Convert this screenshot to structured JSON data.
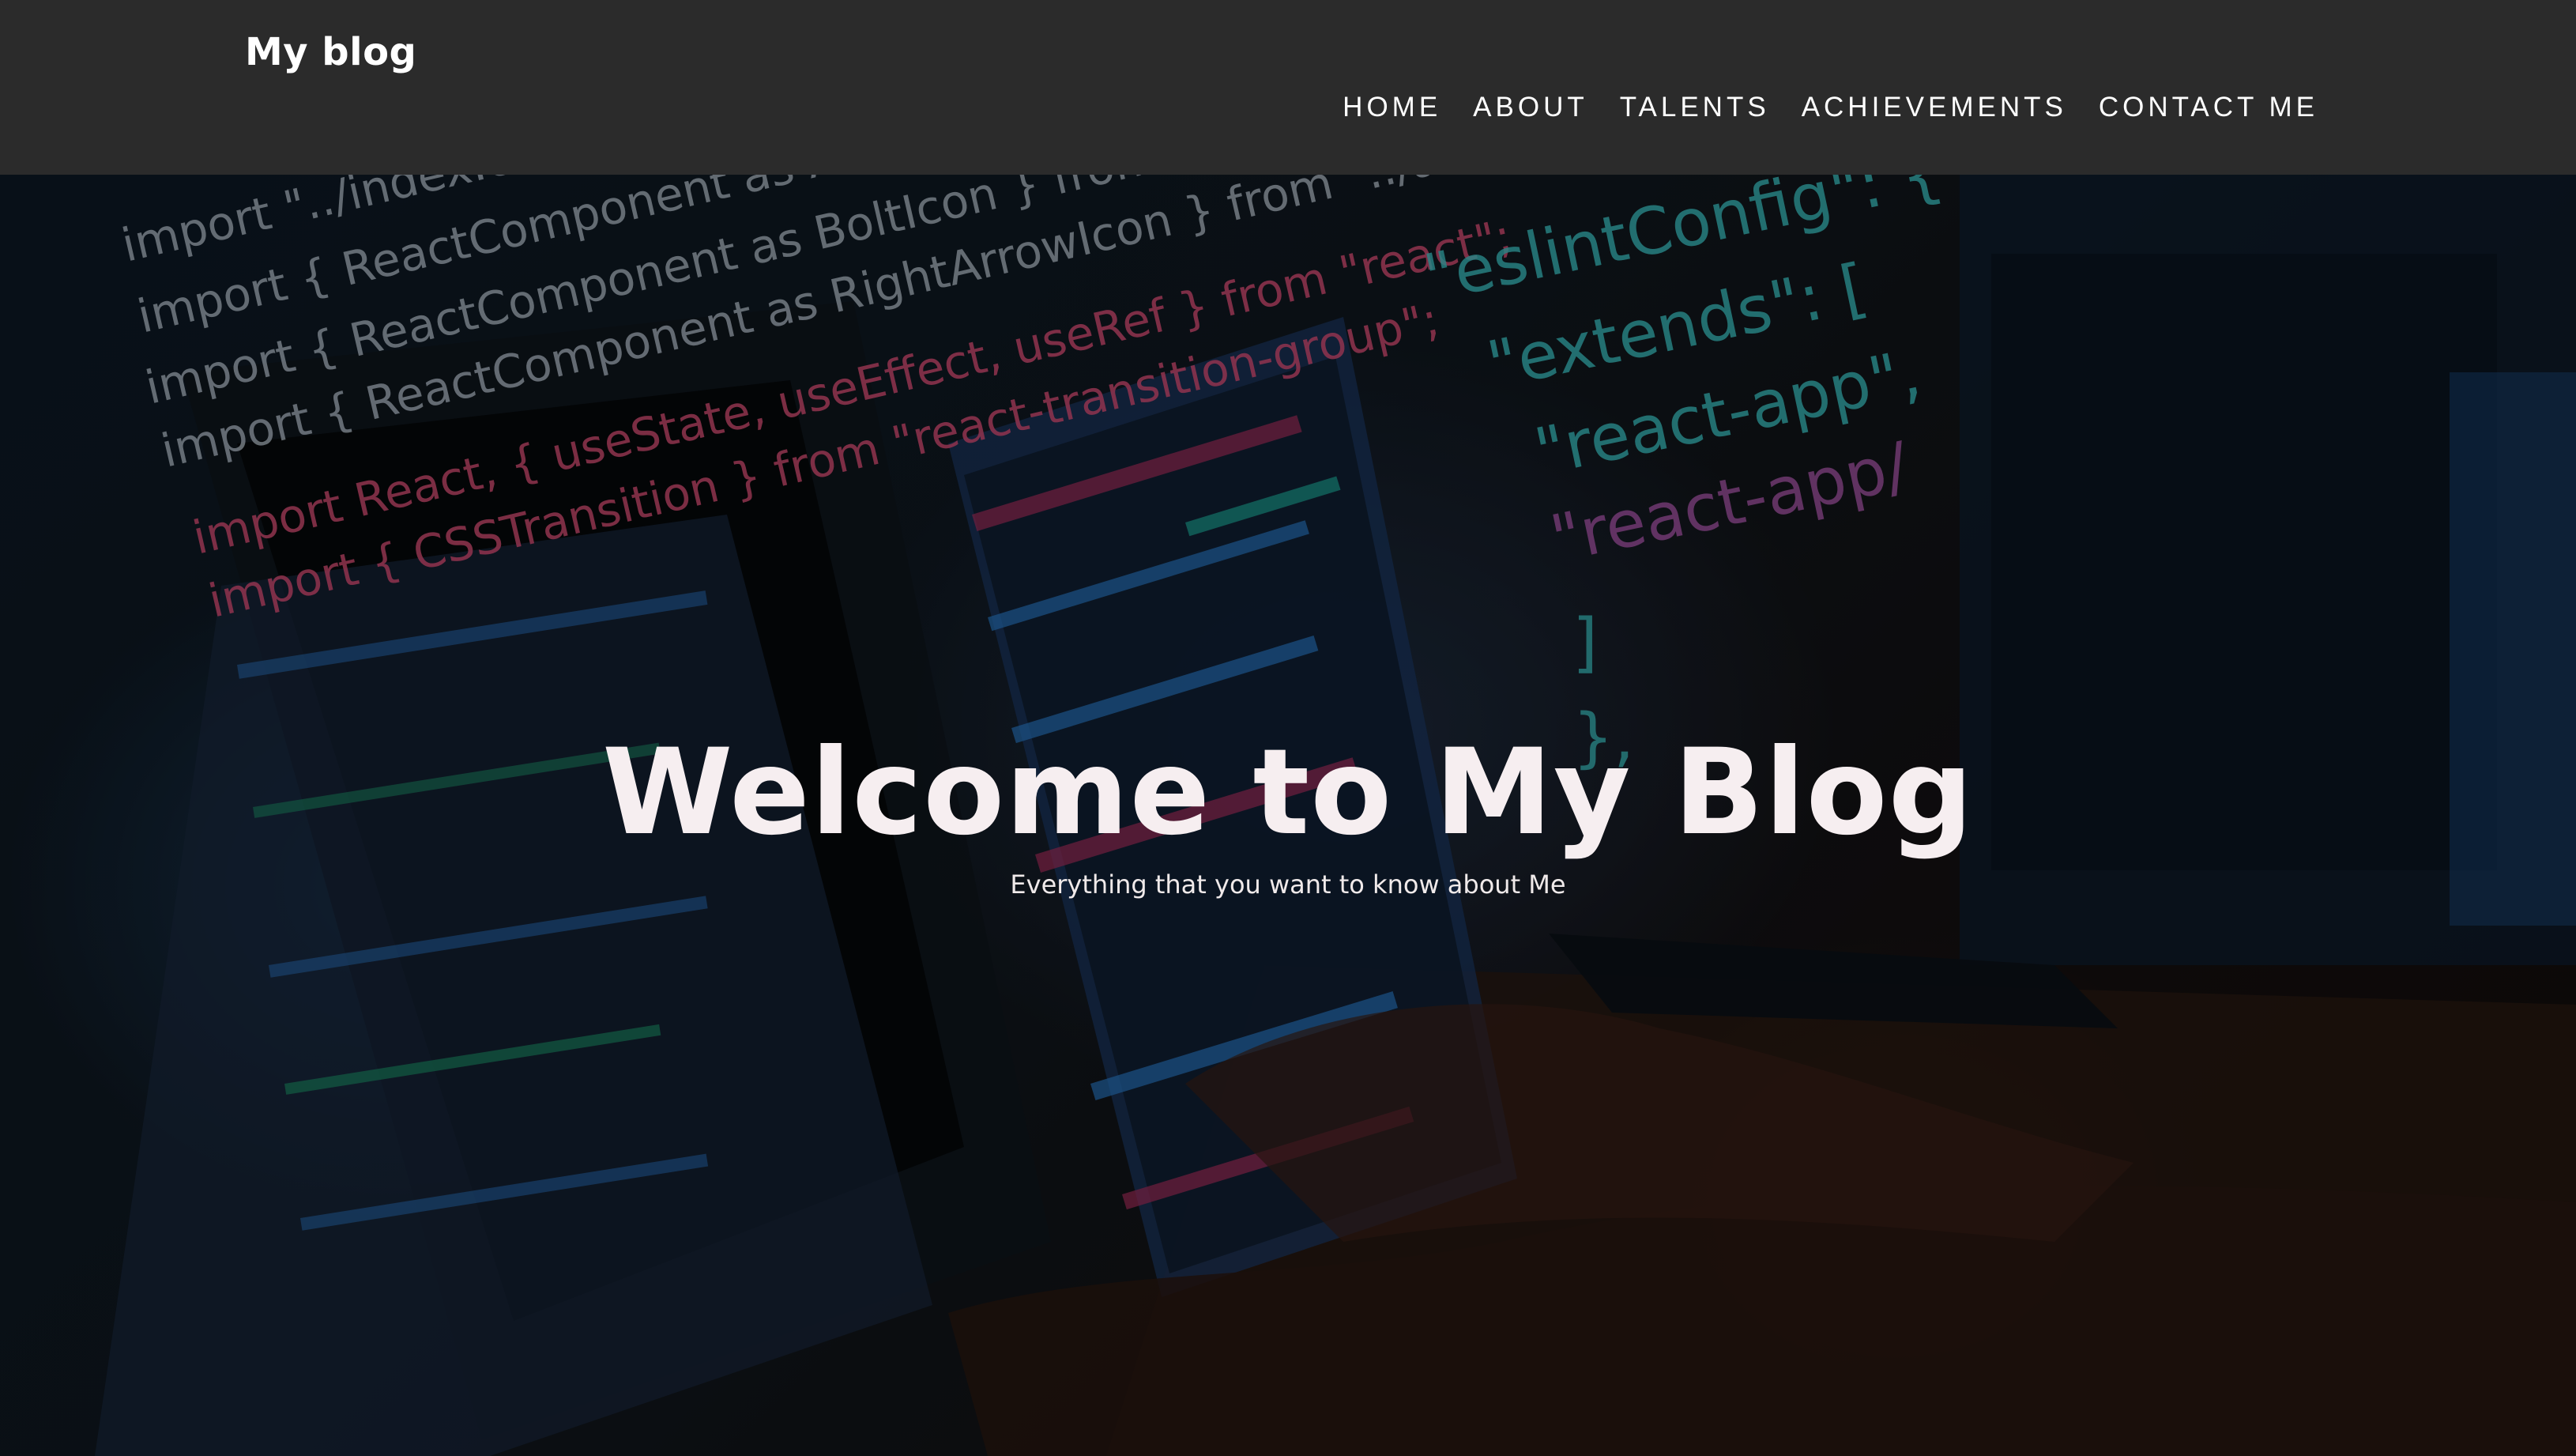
{
  "navbar": {
    "brand": "My blog",
    "links": [
      {
        "label": "HOME"
      },
      {
        "label": "ABOUT"
      },
      {
        "label": "TALENTS"
      },
      {
        "label": "ACHIEVEMENTS"
      },
      {
        "label": "CONTACT ME"
      }
    ]
  },
  "hero": {
    "title": "Welcome to My Blog",
    "subtitle": "Everything that you want to know about Me",
    "background_image": {
      "code_lines": [
        "import \"../index.css\";",
        "import { ReactComponent as ArrowIcon } from \"../assets/icons/ma",
        "import { ReactComponent as BoltIcon } from \"../assets/ic",
        "import { ReactComponent as RightArrowIcon } from \"../assets/icons/ri",
        "import React, { useState, useEffect, useRef } from \"react\";",
        "import { CSSTransition } from \"react-transition-group\";",
        "\"eslintConfig\": {",
        "\"extends\": [",
        "\"react-app\",",
        "\"react-app/",
        "]",
        "},"
      ]
    }
  },
  "colors": {
    "navbar_bg": "#2b2b2b",
    "text_light": "#ffffff",
    "title_color": "#f6eef0",
    "code_pink": "#e0507a",
    "code_cyan": "#3fd0d0",
    "code_white": "#c8d4e0"
  }
}
